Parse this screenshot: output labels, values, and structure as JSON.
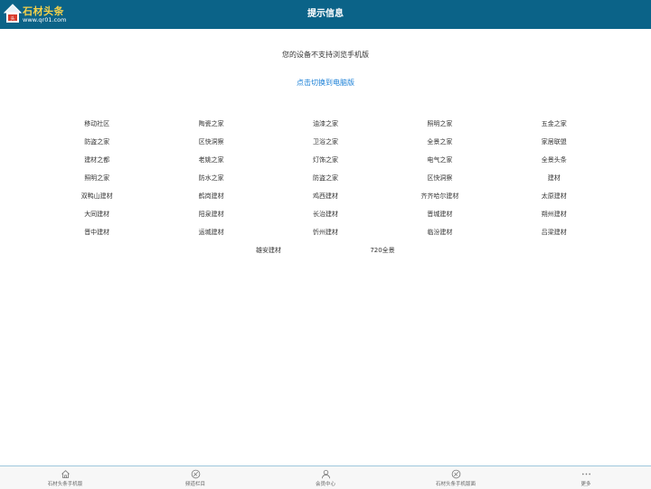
{
  "header": {
    "logo_title": "石材头条",
    "logo_url": "www.qr01.com",
    "title": "提示信息"
  },
  "notice": "您的设备不支持浏览手机版",
  "switch_link": "点击切换到电脑版",
  "links": [
    [
      "移动社区",
      "陶瓷之家",
      "油漆之家",
      "照明之家",
      "五金之家"
    ],
    [
      "防盗之家",
      "区快洞察",
      "卫浴之家",
      "全景之家",
      "家居联盟"
    ],
    [
      "建材之都",
      "老姚之家",
      "灯饰之家",
      "电气之家",
      "全景头条"
    ],
    [
      "照明之家",
      "防水之家",
      "防盗之家",
      "区快洞察",
      "建材"
    ],
    [
      "双鸭山建材",
      "鹤岗建材",
      "鸡西建材",
      "齐齐哈尔建材",
      "太原建材"
    ],
    [
      "大同建材",
      "阳泉建材",
      "长治建材",
      "晋城建材",
      "朔州建材"
    ],
    [
      "晋中建材",
      "运城建材",
      "忻州建材",
      "临汾建材",
      "吕梁建材"
    ]
  ],
  "last_links": [
    "雄安建材",
    "720全景"
  ],
  "footer": {
    "items": [
      {
        "label": "石材头条手机版",
        "icon": "home-icon"
      },
      {
        "label": "频道栏目",
        "icon": "compass-icon"
      },
      {
        "label": "会员中心",
        "icon": "user-icon"
      },
      {
        "label": "石材头条手机版面",
        "icon": "compass-icon"
      },
      {
        "label": "更多",
        "icon": "more-icon"
      }
    ]
  }
}
